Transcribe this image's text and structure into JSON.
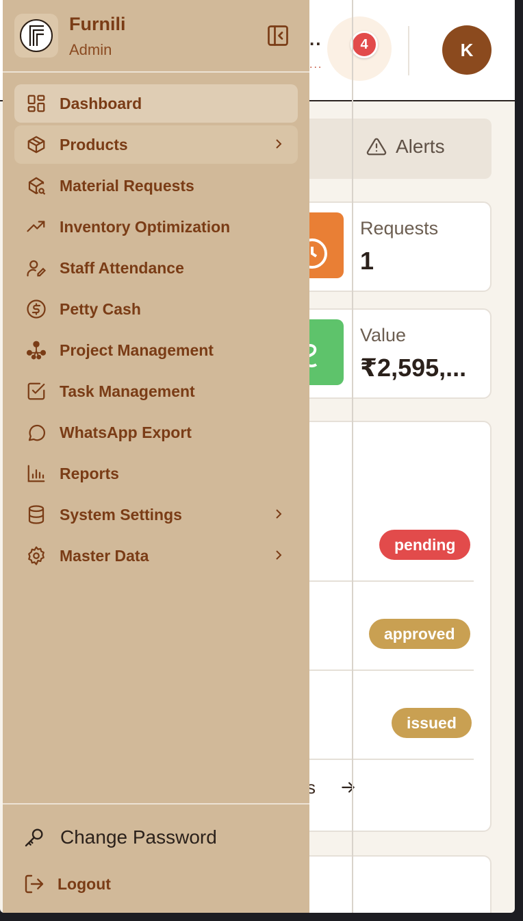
{
  "app": {
    "name": "Furnili",
    "role": "Admin"
  },
  "header": {
    "title_fragment": "..",
    "subtitle_fragment": "...",
    "notification_count": "4",
    "avatar_initial": "K"
  },
  "tabs": {
    "alerts_label": "Alerts"
  },
  "stats": [
    {
      "label": "Requests",
      "value": "1",
      "color": "#e97f35"
    },
    {
      "label": "Value",
      "value": "₹2,595,...",
      "color": "#5ec36b"
    }
  ],
  "statuses": [
    {
      "label": "pending",
      "color": "#e24b4b"
    },
    {
      "label": "approved",
      "color": "#c9a052"
    },
    {
      "label": "issued",
      "color": "#c9a052"
    }
  ],
  "view_all_fragment": "s",
  "nav": [
    {
      "label": "Dashboard",
      "icon": "dashboard-icon"
    },
    {
      "label": "Products",
      "icon": "package-icon"
    },
    {
      "label": "Material Requests",
      "icon": "package-search-icon"
    },
    {
      "label": "Inventory Optimization",
      "icon": "trending-up-icon"
    },
    {
      "label": "Staff Attendance",
      "icon": "user-pen-icon"
    },
    {
      "label": "Petty Cash",
      "icon": "dollar-circle-icon"
    },
    {
      "label": "Project Management",
      "icon": "network-icon"
    },
    {
      "label": "Task Management",
      "icon": "square-check-icon"
    },
    {
      "label": "WhatsApp Export",
      "icon": "message-circle-icon"
    },
    {
      "label": "Reports",
      "icon": "bar-chart-icon"
    },
    {
      "label": "System Settings",
      "icon": "database-icon"
    },
    {
      "label": "Master Data",
      "icon": "settings-icon"
    }
  ],
  "footer": {
    "change_password": "Change Password",
    "logout": "Logout"
  },
  "colors": {
    "drawer_bg": "#d1b999",
    "brand": "#7a3c16",
    "accent": "#8b4a1e"
  }
}
